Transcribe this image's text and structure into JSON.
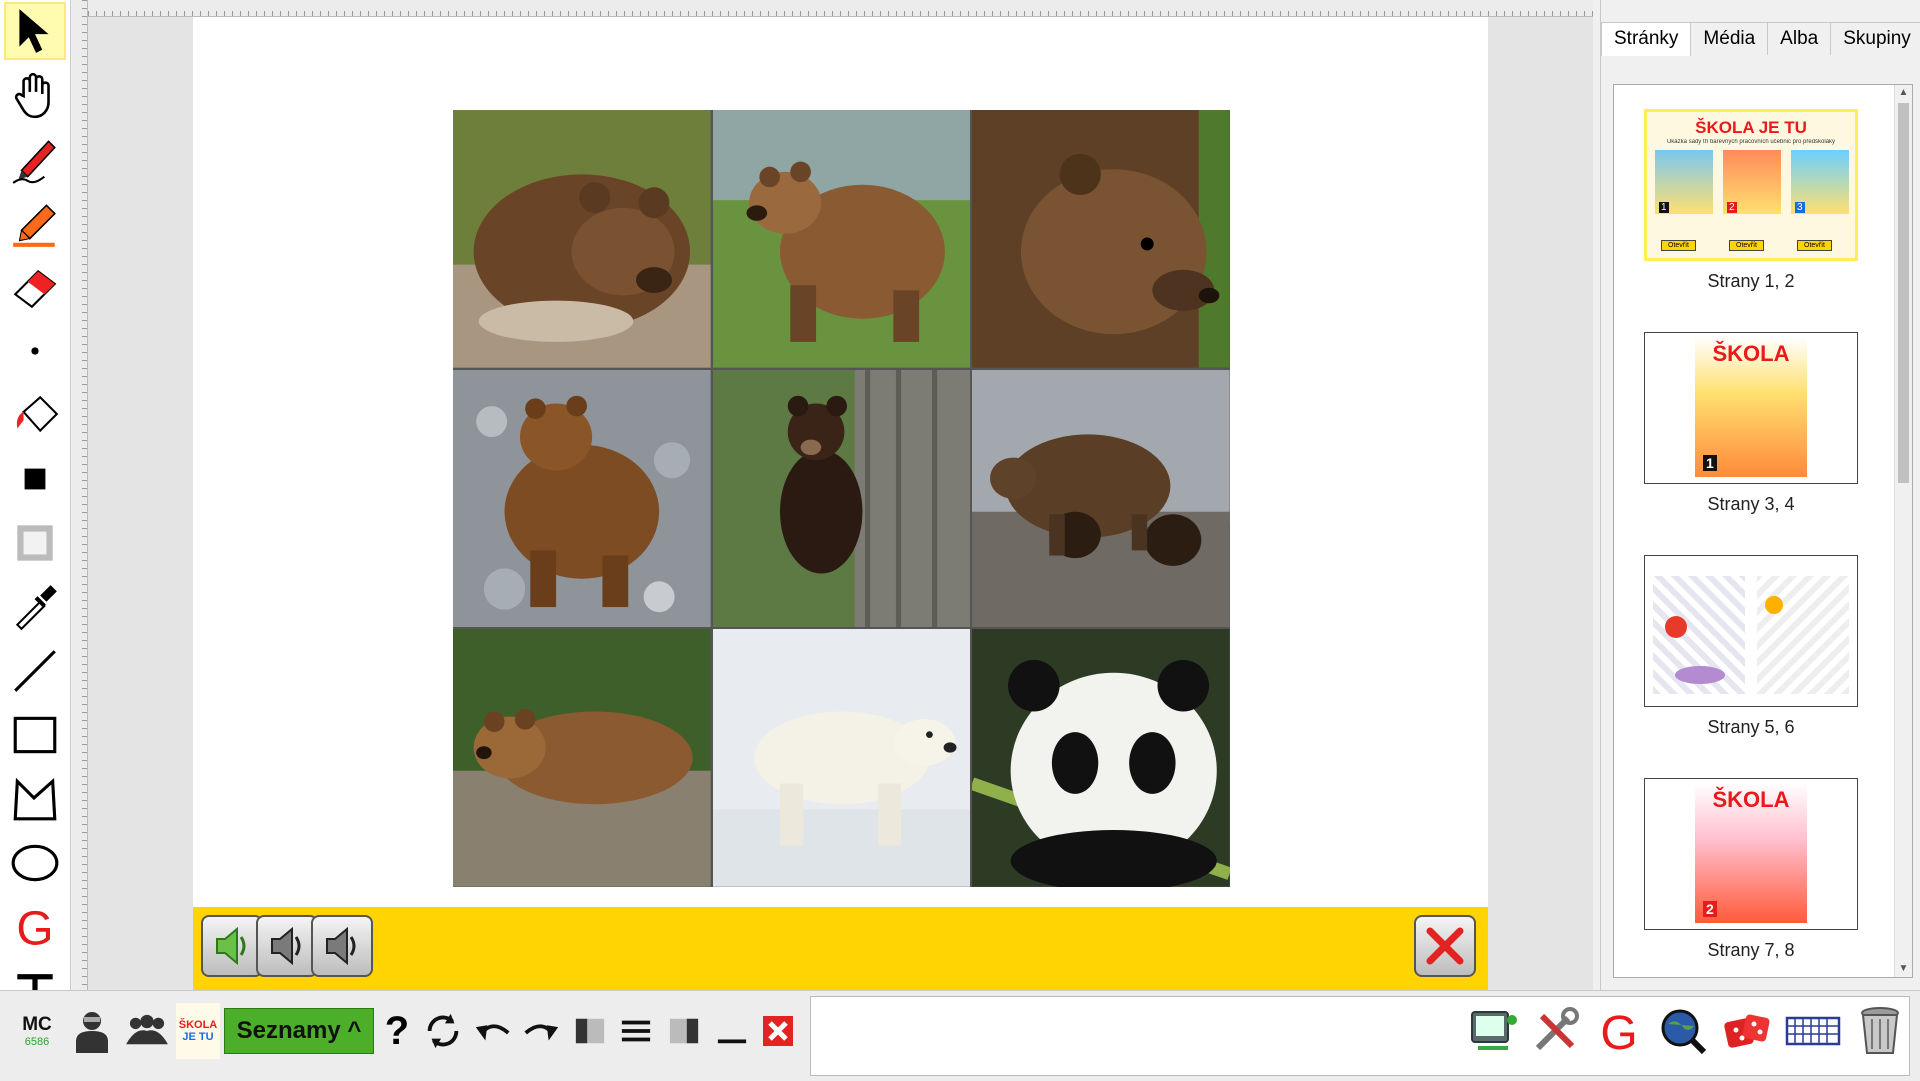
{
  "left_toolbar": {
    "tools": [
      "select-arrow-icon",
      "hand-icon",
      "pen-icon",
      "highlighter-icon",
      "eraser-icon",
      "dot-icon",
      "fill-bucket-icon",
      "filled-square-icon",
      "frame-square-icon",
      "eyedropper-icon",
      "line-icon",
      "rectangle-icon",
      "polygon-icon",
      "ellipse-icon",
      "g-logo-icon",
      "text-icon"
    ]
  },
  "tabs": [
    {
      "label": "Stránky",
      "active": true
    },
    {
      "label": "Média",
      "active": false
    },
    {
      "label": "Alba",
      "active": false
    },
    {
      "label": "Skupiny",
      "active": false
    }
  ],
  "thumbnails": [
    {
      "label": "Strany 1, 2",
      "selected": true,
      "title": "ŠKOLA JE TU",
      "subtitle": "Ukázka sady tří barevných pracovních učebnic pro předškoláky",
      "buttons": [
        "Otevřít",
        "Otevřít",
        "Otevřít"
      ],
      "numbers": [
        "1",
        "2",
        "3"
      ]
    },
    {
      "label": "Strany 3, 4",
      "selected": false,
      "title": "ŠKOLA",
      "number": "1"
    },
    {
      "label": "Strany 5, 6",
      "selected": false
    },
    {
      "label": "Strany 7, 8",
      "selected": false,
      "title": "ŠKOLA",
      "number": "2"
    }
  ],
  "audio_bar": {
    "buttons": [
      "speaker-green-icon",
      "speaker-gray-icon",
      "speaker-gray-icon"
    ],
    "close": "close-x-icon"
  },
  "bottom_bar": {
    "mc_label": "MC",
    "mc_number": "6586",
    "skola_logo_top": "ŠKOLA",
    "skola_logo_bottom": "JE TU",
    "seznamy": "Seznamy ^",
    "help": "?",
    "right_icons": [
      "tablet-icon",
      "tools-icon",
      "g-logo-icon",
      "globe-search-icon",
      "dice-icon",
      "keyboard-icon",
      "trash-icon"
    ]
  },
  "colors": {
    "accent_yellow": "#ffd400",
    "seznamy_green": "#4caf2a",
    "g_red": "#e81a1a"
  }
}
